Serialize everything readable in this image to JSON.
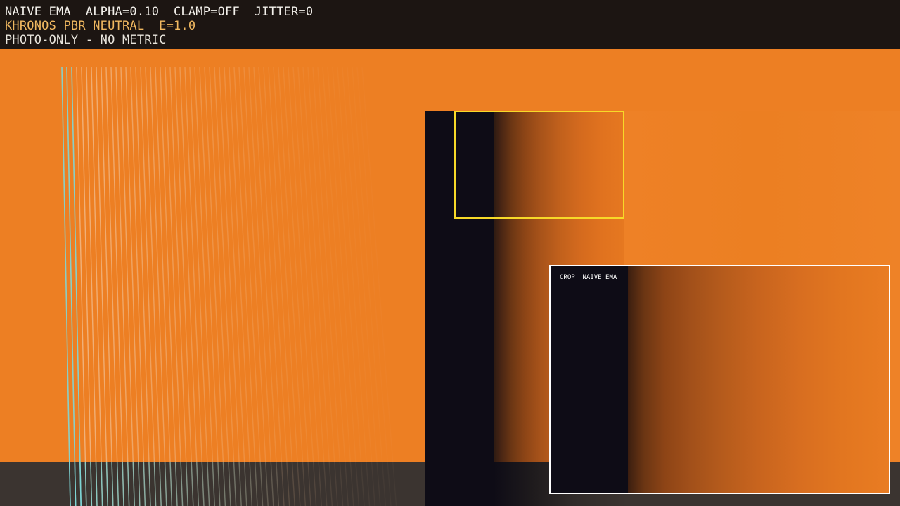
{
  "hud": {
    "line1": "NAIVE EMA  ALPHA=0.10  CLAMP=OFF  JITTER=0",
    "line2": "KHRONOS PBR NEUTRAL  E=1.0",
    "line3": "PHOTO-ONLY - NO METRIC"
  },
  "inset": {
    "label": "CROP  NAIVE EMA"
  },
  "colors": {
    "background": "#ed7f23",
    "hud_bg": "#1c1512",
    "hud_accent": "#f0b860",
    "pillar": "#0e0c16",
    "roi_border": "#f7d928",
    "inset_border": "#ffffff",
    "fence_cyan": "#7fd8d8",
    "floor": "#3b3430"
  }
}
